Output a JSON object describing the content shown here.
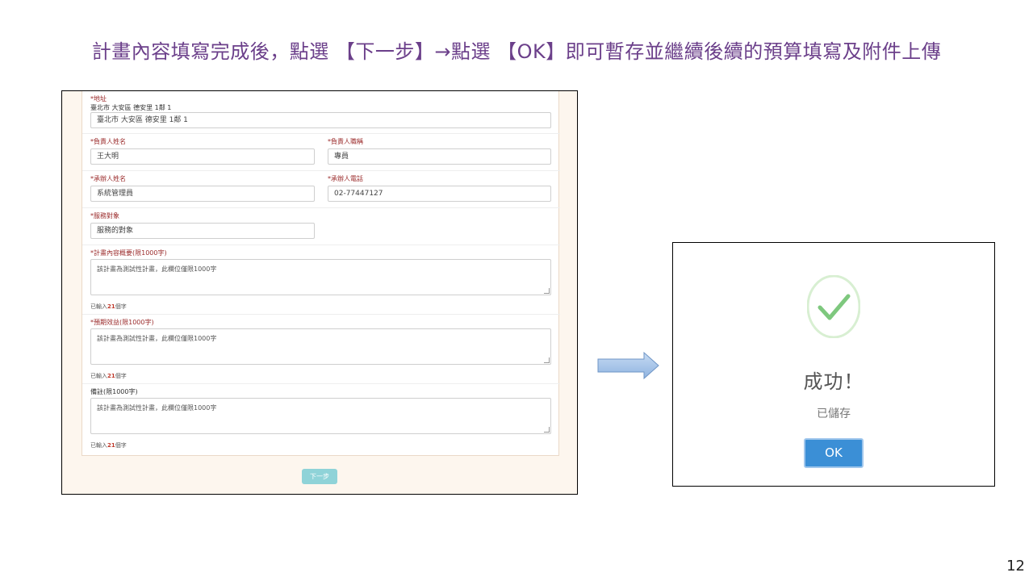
{
  "slide": {
    "title": "計畫內容填寫完成後，點選 【下一步】→點選 【OK】即可暫存並繼續後續的預算填寫及附件上傳",
    "page_number": "12"
  },
  "form": {
    "address": {
      "label": "*地址",
      "sub": "臺北市 大安區 德安里 1鄰 1",
      "value": "臺北市 大安區 德安里 1鄰 1"
    },
    "responsible_name": {
      "label": "*負責人姓名",
      "value": "王大明"
    },
    "responsible_title": {
      "label": "*負責人職稱",
      "value": "專員"
    },
    "contractor_name": {
      "label": "*承辦人姓名",
      "value": "系統管理員"
    },
    "contractor_phone": {
      "label": "*承辦人電話",
      "value": "02-77447127"
    },
    "service_target": {
      "label": "*服務對象",
      "value": "服務的對象"
    },
    "plan_summary": {
      "label": "*計畫內容概要(限1000字)",
      "value": "該計畫為測試性計畫，此欄位僅限1000字",
      "count_prefix": "已輸入",
      "count": "21",
      "count_suffix": "個字"
    },
    "expected_benefit": {
      "label": "*預期效益(限1000字)",
      "value": "該計畫為測試性計畫，此欄位僅限1000字",
      "count_prefix": "已輸入",
      "count": "21",
      "count_suffix": "個字"
    },
    "remarks": {
      "label": "備註(限1000字)",
      "value": "該計畫為測試性計畫，此欄位僅限1000字",
      "count_prefix": "已輸入",
      "count": "21",
      "count_suffix": "個字"
    },
    "next_button": "下一步"
  },
  "dialog": {
    "title": "成功！",
    "text": "已儲存",
    "ok_button": "OK",
    "icon": "check-icon",
    "icon_color": "#7ec87e"
  },
  "colors": {
    "title": "#6b3f8a",
    "required_label": "#9b2b2b",
    "next_button": "#8fd3d8",
    "ok_button": "#3b8fd6",
    "arrow": "#9dbde3"
  }
}
